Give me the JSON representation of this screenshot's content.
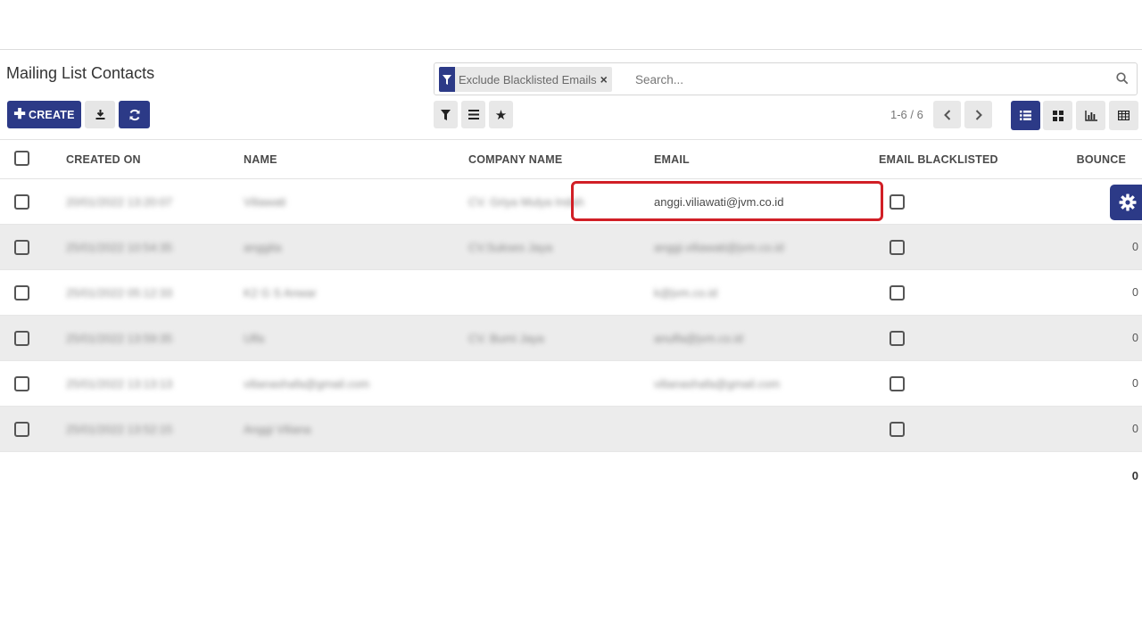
{
  "page": {
    "title": "Mailing List Contacts"
  },
  "toolbar": {
    "create_label": "CREATE",
    "download_icon": "download-icon",
    "refresh_icon": "refresh-icon"
  },
  "search": {
    "facet_label": "Exclude Blacklisted Emails",
    "facet_icon": "filter-icon",
    "placeholder": "Search...",
    "value": ""
  },
  "filters": {
    "filter_icon": "filter-icon",
    "groupby_icon": "list-icon",
    "favorites_icon": "star-icon"
  },
  "pager": {
    "text": "1-6 / 6"
  },
  "views": {
    "list": "list-view-icon",
    "kanban": "kanban-view-icon",
    "graph": "graph-view-icon",
    "pivot": "pivot-view-icon",
    "active": "list"
  },
  "table": {
    "columns": {
      "created_on": "CREATED ON",
      "name": "NAME",
      "company": "COMPANY NAME",
      "email": "EMAIL",
      "blacklisted": "EMAIL BLACKLISTED",
      "bounce": "BOUNCE"
    },
    "rows": [
      {
        "created_on": "20/01/2022 13:20:07",
        "name": "Viliawati",
        "company": "CV. Griya Mulya Indah",
        "email": "anggi.viliawati@jvm.co.id",
        "bounce": "",
        "email_blurred": false
      },
      {
        "created_on": "25/01/2022 10:54:35",
        "name": "anggita",
        "company": "CV.Sukses Jaya",
        "email": "anggi.viliawati@jvm.co.id",
        "bounce": "0",
        "email_blurred": true
      },
      {
        "created_on": "25/01/2022 05:12:33",
        "name": "K2 G S Anwar",
        "company": "",
        "email": "k@jvm.co.id",
        "bounce": "0",
        "email_blurred": true
      },
      {
        "created_on": "25/01/2022 13:59:35",
        "name": "Ulfa",
        "company": "CV. Bumi Jaya",
        "email": "anulfa@jvm.co.id",
        "bounce": "0",
        "email_blurred": true
      },
      {
        "created_on": "25/01/2022 13:13:13",
        "name": "vilianashafa@gmail.com",
        "company": "",
        "email": "vilianashafa@gmail.com",
        "bounce": "0",
        "email_blurred": true
      },
      {
        "created_on": "25/01/2022 13:52:15",
        "name": "Anggi Viliana",
        "company": "",
        "email": "",
        "bounce": "0",
        "email_blurred": true
      }
    ],
    "total_bounce": "0"
  },
  "colors": {
    "primary": "#2c3a87",
    "highlight": "#d11f26",
    "row_alt": "#ececec"
  }
}
